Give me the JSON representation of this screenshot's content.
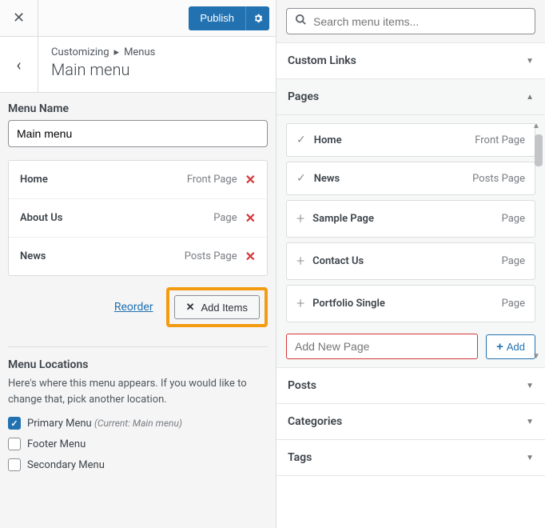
{
  "topbar": {
    "publish": "Publish"
  },
  "header": {
    "breadcrumb_parent": "Customizing",
    "breadcrumb_current": "Menus",
    "title": "Main menu"
  },
  "menu": {
    "name_label": "Menu Name",
    "name_value": "Main menu",
    "items": [
      {
        "label": "Home",
        "type": "Front Page"
      },
      {
        "label": "About Us",
        "type": "Page"
      },
      {
        "label": "News",
        "type": "Posts Page"
      }
    ],
    "reorder": "Reorder",
    "add_items": "Add Items"
  },
  "locations": {
    "title": "Menu Locations",
    "description": "Here's where this menu appears. If you would like to change that, pick another location.",
    "options": [
      {
        "label": "Primary Menu",
        "current": "(Current: Main menu)",
        "checked": true
      },
      {
        "label": "Footer Menu",
        "current": "",
        "checked": false
      },
      {
        "label": "Secondary Menu",
        "current": "",
        "checked": false
      }
    ]
  },
  "search": {
    "placeholder": "Search menu items..."
  },
  "sections": {
    "custom_links": "Custom Links",
    "pages": "Pages",
    "posts": "Posts",
    "categories": "Categories",
    "tags": "Tags"
  },
  "pages": [
    {
      "label": "Home",
      "type": "Front Page",
      "added": true
    },
    {
      "label": "News",
      "type": "Posts Page",
      "added": true
    },
    {
      "label": "Sample Page",
      "type": "Page",
      "added": false
    },
    {
      "label": "Contact Us",
      "type": "Page",
      "added": false
    },
    {
      "label": "Portfolio Single",
      "type": "Page",
      "added": false
    }
  ],
  "add_page": {
    "placeholder": "Add New Page",
    "button": "Add"
  }
}
